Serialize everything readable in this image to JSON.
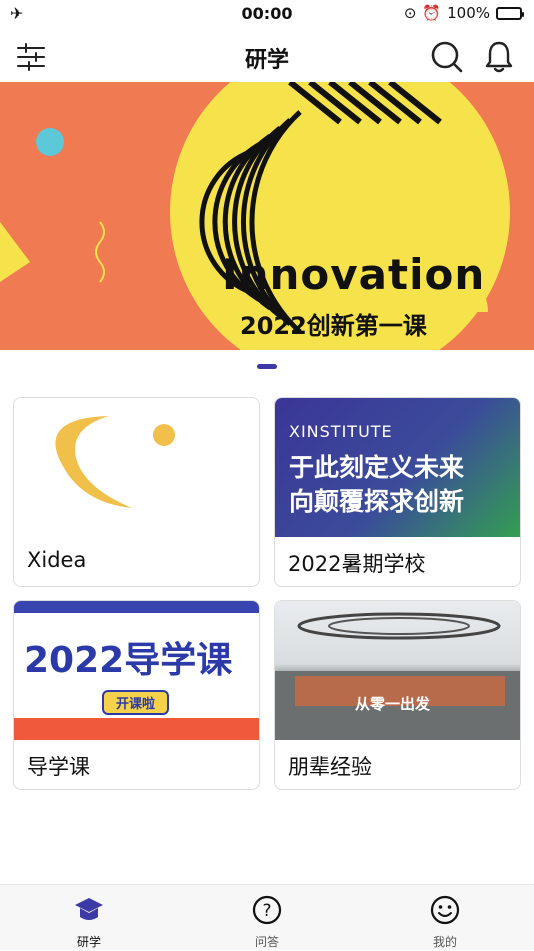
{
  "status": {
    "time": "00:00",
    "battery": "100%"
  },
  "header": {
    "title": "研学"
  },
  "banner": {
    "headline": "Innovation",
    "subline": "2022创新第一课"
  },
  "cards": [
    {
      "label": "Xidea"
    },
    {
      "label": "2022暑期学校",
      "image_top": "XINSTITUTE",
      "image_line1": "于此刻定义未来",
      "image_line2": "向颠覆探求创新"
    },
    {
      "label": "导学课",
      "image_title": "2022导学课",
      "image_badge": "开课啦"
    },
    {
      "label": "朋辈经验",
      "image_caption": "从零一出发"
    }
  ],
  "tabs": [
    {
      "label": "研学",
      "icon": "graduation-cap-icon"
    },
    {
      "label": "问答",
      "icon": "question-circle-icon"
    },
    {
      "label": "我的",
      "icon": "smiley-icon"
    }
  ],
  "colors": {
    "accent": "#3d3aa6",
    "banner_bg": "#f07a52",
    "banner_yellow": "#f6e24a"
  }
}
